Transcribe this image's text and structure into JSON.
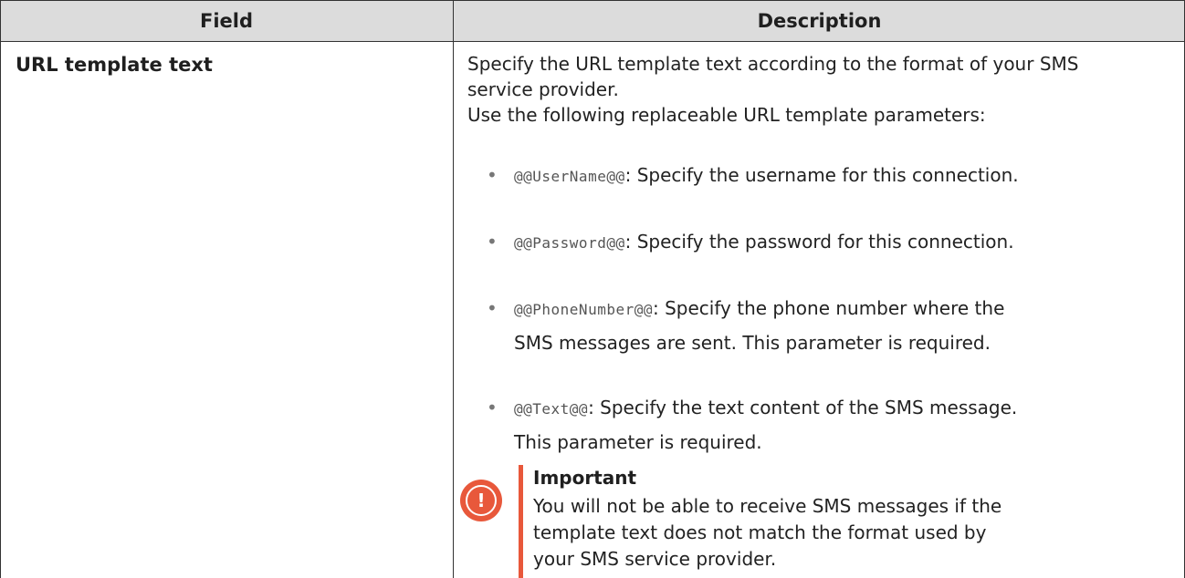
{
  "table": {
    "headers": [
      "Field",
      "Description"
    ],
    "row": {
      "field": "URL template text",
      "intro_line1": "Specify the URL template text according to the format of your SMS",
      "intro_line2": "service provider.",
      "intro_line3": "Use the following replaceable URL template parameters:",
      "params": [
        {
          "code": "@@UserName@@",
          "lines": [
            ": Specify the username for this connection."
          ]
        },
        {
          "code": "@@Password@@",
          "lines": [
            ": Specify the password for this connection."
          ]
        },
        {
          "code": "@@PhoneNumber@@",
          "lines": [
            ": Specify the phone number where the",
            "SMS messages are sent. This parameter is required."
          ]
        },
        {
          "code": "@@Text@@",
          "lines": [
            ": Specify the text content of the SMS message.",
            "This parameter is required."
          ]
        }
      ],
      "note": {
        "icon": "exclamation-icon",
        "title": "Important",
        "lines": [
          "You will not be able to receive SMS messages if the",
          "template text does not match the format used by",
          "your SMS service provider."
        ]
      }
    }
  },
  "colors": {
    "header_bg": "#dcdcdc",
    "border": "#333333",
    "important_accent": "#e8583b"
  }
}
